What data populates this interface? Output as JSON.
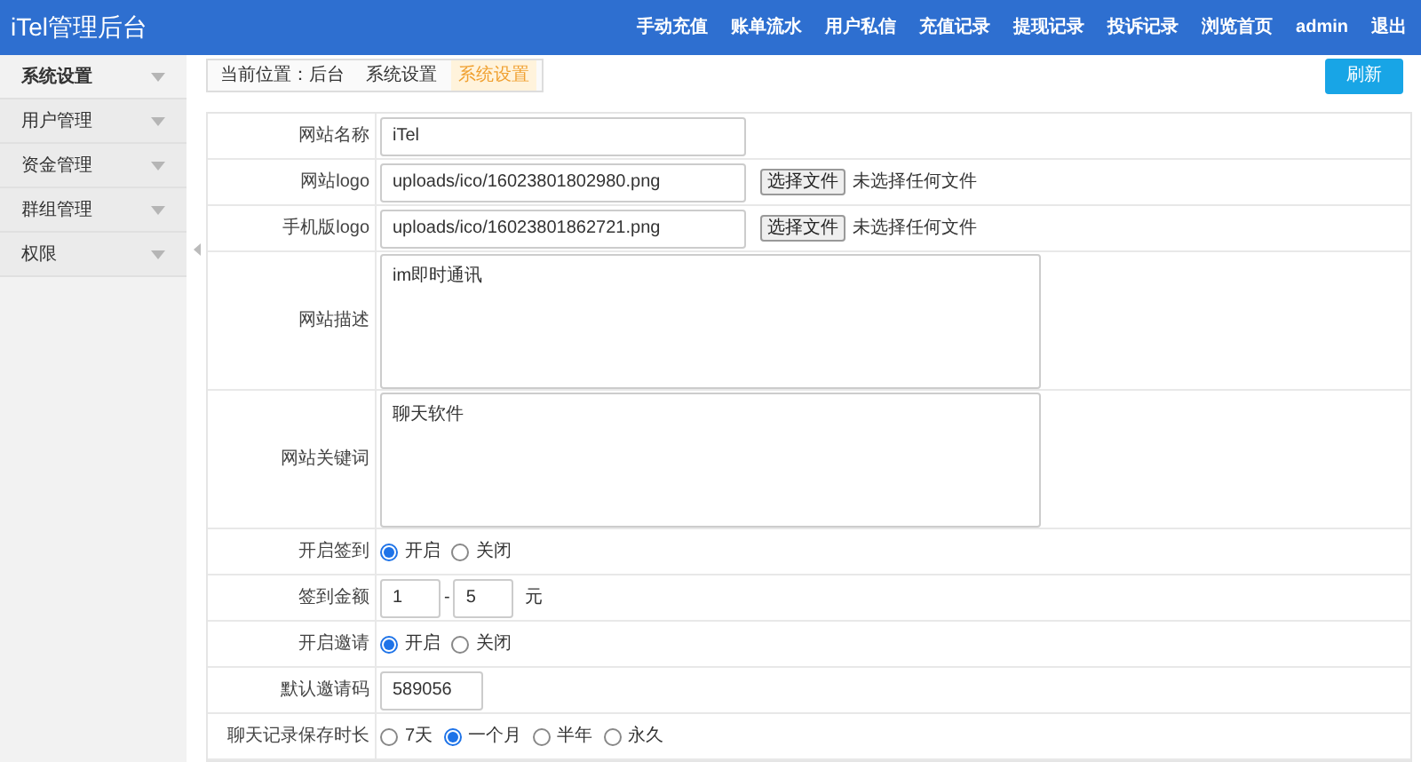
{
  "header": {
    "title": "iTel管理后台",
    "nav": [
      "手动充值",
      "账单流水",
      "用户私信",
      "充值记录",
      "提现记录",
      "投诉记录",
      "浏览首页",
      "admin",
      "退出"
    ]
  },
  "sidebar": {
    "items": [
      {
        "label": "系统设置",
        "selected": true
      },
      {
        "label": "用户管理",
        "selected": false
      },
      {
        "label": "资金管理",
        "selected": false
      },
      {
        "label": "群组管理",
        "selected": false
      },
      {
        "label": "权限",
        "selected": false
      }
    ]
  },
  "breadcrumb": {
    "items": [
      {
        "label": "当前位置：后台",
        "selected": false
      },
      {
        "label": "系统设置",
        "selected": false
      },
      {
        "label": "系统设置",
        "selected": true
      }
    ],
    "refresh_button": "刷新"
  },
  "form": {
    "rows": [
      {
        "kind": "text",
        "label": "网站名称",
        "value": "iTel"
      },
      {
        "kind": "file",
        "label": "网站logo",
        "value": "uploads/ico/16023801802980.png",
        "button": "选择文件",
        "status": "未选择任何文件"
      },
      {
        "kind": "file",
        "label": "手机版logo",
        "value": "uploads/ico/16023801862721.png",
        "button": "选择文件",
        "status": "未选择任何文件"
      },
      {
        "kind": "textarea",
        "label": "网站描述",
        "value": "im即时通讯"
      },
      {
        "kind": "textarea",
        "label": "网站关键词",
        "value": "聊天软件"
      },
      {
        "kind": "radio",
        "label": "开启签到",
        "options": [
          {
            "label": "开启",
            "selected": true
          },
          {
            "label": "关闭",
            "selected": false
          }
        ]
      },
      {
        "kind": "range",
        "label": "签到金额",
        "from": "1",
        "separator": "-",
        "to": "5",
        "unit": "元"
      },
      {
        "kind": "radio",
        "label": "开启邀请",
        "options": [
          {
            "label": "开启",
            "selected": true
          },
          {
            "label": "关闭",
            "selected": false
          }
        ]
      },
      {
        "kind": "text",
        "label": "默认邀请码",
        "value": "589056"
      },
      {
        "kind": "radio",
        "label": "聊天记录保存时长",
        "options": [
          {
            "label": "7天",
            "selected": false
          },
          {
            "label": "一个月",
            "selected": true
          },
          {
            "label": "半年",
            "selected": false
          },
          {
            "label": "永久",
            "selected": false
          }
        ]
      }
    ]
  }
}
